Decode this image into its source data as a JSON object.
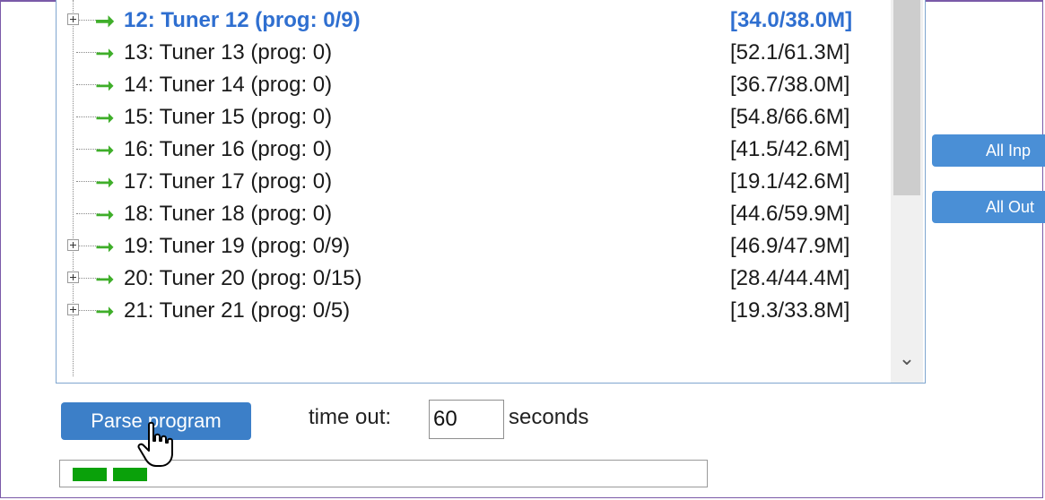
{
  "tree": {
    "rows": [
      {
        "label": "12: Tuner 12 (prog: 0/9)",
        "size": "[34.0/38.0M]",
        "expandable": true,
        "selected": true
      },
      {
        "label": "13: Tuner 13 (prog: 0)",
        "size": "[52.1/61.3M]",
        "expandable": false,
        "selected": false
      },
      {
        "label": "14: Tuner 14 (prog: 0)",
        "size": "[36.7/38.0M]",
        "expandable": false,
        "selected": false
      },
      {
        "label": "15: Tuner 15 (prog: 0)",
        "size": "[54.8/66.6M]",
        "expandable": false,
        "selected": false
      },
      {
        "label": "16: Tuner 16 (prog: 0)",
        "size": "[41.5/42.6M]",
        "expandable": false,
        "selected": false
      },
      {
        "label": "17: Tuner 17 (prog: 0)",
        "size": "[19.1/42.6M]",
        "expandable": false,
        "selected": false
      },
      {
        "label": "18: Tuner 18 (prog: 0)",
        "size": "[44.6/59.9M]",
        "expandable": false,
        "selected": false
      },
      {
        "label": "19: Tuner 19 (prog: 0/9)",
        "size": "[46.9/47.9M]",
        "expandable": true,
        "selected": false
      },
      {
        "label": "20: Tuner 20 (prog: 0/15)",
        "size": "[28.4/44.4M]",
        "expandable": true,
        "selected": false
      },
      {
        "label": "21: Tuner 21 (prog: 0/5)",
        "size": "[19.3/33.8M]",
        "expandable": true,
        "selected": false
      }
    ],
    "scroll_down_glyph": "⌄"
  },
  "side_buttons": {
    "all_inputs": "All Inp",
    "all_outputs": "All Out"
  },
  "controls": {
    "parse_button": "Parse program",
    "timeout_label": "time out:",
    "timeout_value": "60",
    "seconds_label": "seconds"
  },
  "progress": {
    "segments_filled": 2
  },
  "icons": {
    "arrow": "arrow-right-icon",
    "expand": "plus-box-icon",
    "cursor": "hand-pointer-icon"
  },
  "colors": {
    "selected_text": "#2f6fd0",
    "arrow": "#3fae2a",
    "button": "#3c7fc8",
    "progress": "#0aa10a"
  }
}
